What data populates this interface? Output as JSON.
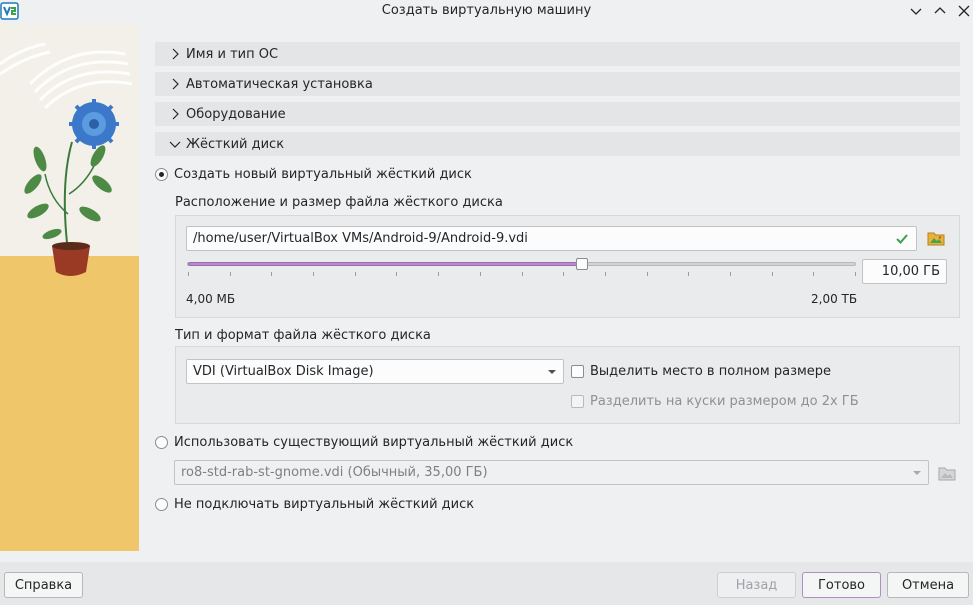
{
  "window": {
    "title": "Создать виртуальную машину",
    "controls": [
      "minimize-icon",
      "maximize-icon",
      "close-icon"
    ]
  },
  "sections": [
    {
      "label": "Имя и тип ОС",
      "expanded": false
    },
    {
      "label": "Автоматическая установка",
      "expanded": false
    },
    {
      "label": "Оборудование",
      "expanded": false
    },
    {
      "label": "Жёсткий диск",
      "expanded": true
    }
  ],
  "disk": {
    "option_create": "Создать новый виртуальный жёсткий диск",
    "location_group_label": "Расположение и размер файла жёсткого диска",
    "location_value": "/home/user/VirtualBox VMs/Android-9/Android-9.vdi",
    "size_value": "10,00 ГБ",
    "size_min_label": "4,00 МБ",
    "size_max_label": "2,00 ТБ",
    "slider_fraction": 0.59,
    "format_group_label": "Тип и формат файла жёсткого диска",
    "format_value": "VDI (VirtualBox Disk Image)",
    "preallocate_label": "Выделить место в полном размере",
    "split_label": "Разделить на куски размером до 2х ГБ",
    "option_existing": "Использовать существующий виртуальный жёсткий диск",
    "existing_value": "ro8-std-rab-st-gnome.vdi (Обычный, 35,00 ГБ)",
    "option_none": "Не подключать виртуальный жёсткий диск"
  },
  "footer": {
    "help": "Справка",
    "back": "Назад",
    "done": "Готово",
    "cancel": "Отмена"
  },
  "colors": {
    "accent": "#b78ac9",
    "section_bg": "#e3e5e7",
    "window_bg": "#eff0f1"
  }
}
